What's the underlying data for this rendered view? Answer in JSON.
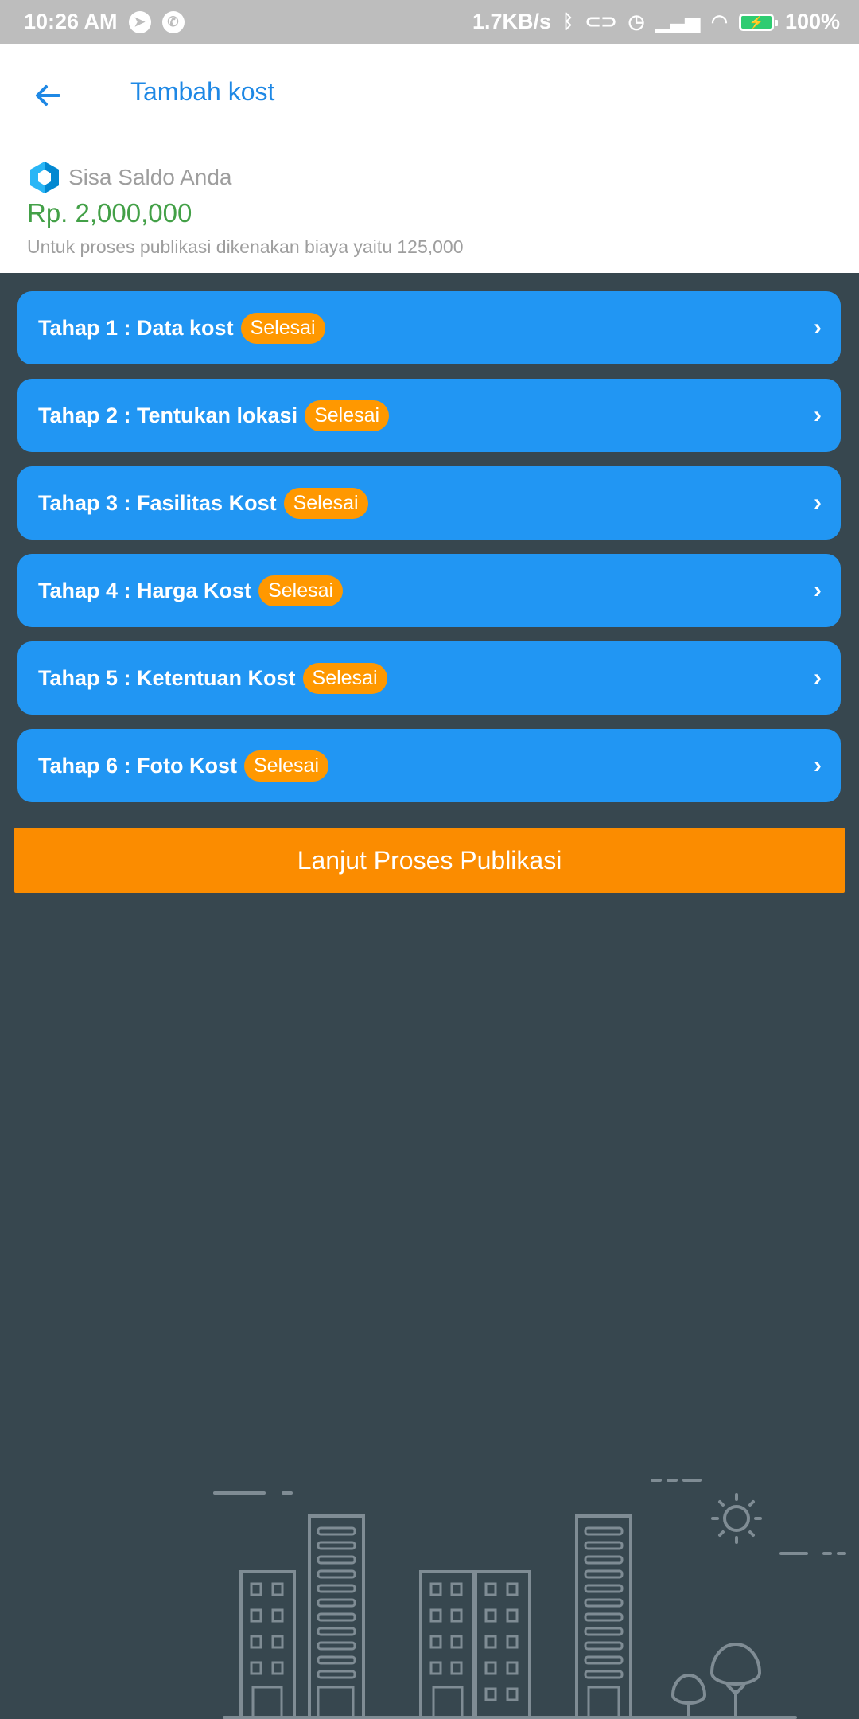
{
  "status_bar": {
    "time": "10:26 AM",
    "network_speed": "1.7KB/s",
    "battery": "100%",
    "icons": [
      "telegram-icon",
      "whatsapp-icon",
      "bluetooth-icon",
      "toggle-icon",
      "alarm-icon",
      "signal-icon",
      "wifi-icon",
      "battery-icon"
    ]
  },
  "header": {
    "title": "Tambah kost",
    "back_icon": "arrow-left-icon"
  },
  "balance": {
    "label": "Sisa Saldo Anda",
    "amount": "Rp. 2,000,000",
    "note": "Untuk proses publikasi dikenakan biaya yaitu 125,000",
    "amount_color": "#43a047"
  },
  "steps": [
    {
      "label": "Tahap 1 : Data kost",
      "status": "Selesai"
    },
    {
      "label": "Tahap 2 : Tentukan lokasi",
      "status": "Selesai"
    },
    {
      "label": "Tahap 3 : Fasilitas Kost",
      "status": "Selesai"
    },
    {
      "label": "Tahap 4 : Harga Kost",
      "status": "Selesai"
    },
    {
      "label": "Tahap 5 : Ketentuan Kost",
      "status": "Selesai"
    },
    {
      "label": "Tahap 6 : Foto Kost",
      "status": "Selesai"
    }
  ],
  "publish_button": {
    "label": "Lanjut Proses Publikasi"
  },
  "colors": {
    "accent": "#2196f3",
    "badge": "#ff9800",
    "button": "#fb8c00",
    "background": "#37474f",
    "title": "#1e88e5"
  }
}
